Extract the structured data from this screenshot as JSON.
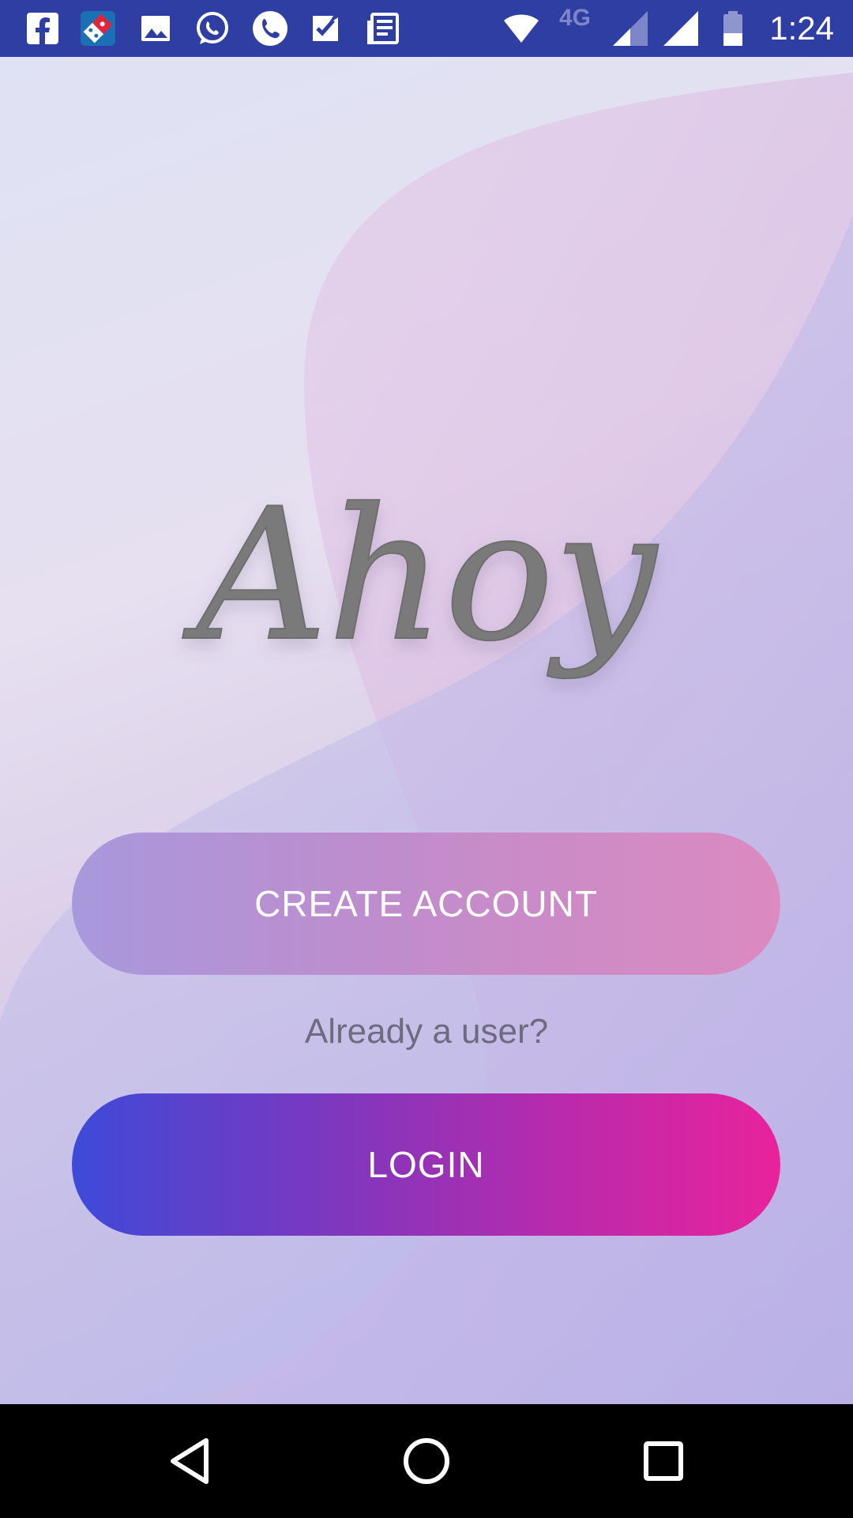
{
  "status_bar": {
    "time": "1:24",
    "network_type": "4G",
    "left_icons": [
      "facebook-icon",
      "dominos-icon",
      "gallery-icon",
      "whatsapp-icon",
      "phone-icon",
      "tasks-icon",
      "news-icon"
    ],
    "right_icons": [
      "wifi-icon",
      "signal-icon",
      "signal-icon",
      "battery-icon"
    ],
    "background_color": "#2f3ea3"
  },
  "app": {
    "logo_text": "Ahoy",
    "create_account_label": "CREATE ACCOUNT",
    "already_user_text": "Already a user?",
    "login_label": "LOGIN",
    "colors": {
      "create_gradient": [
        "#a898dd",
        "#dc8ac0"
      ],
      "login_gradient": [
        "#3e4ad8",
        "#ea229c"
      ]
    }
  },
  "nav_bar": {
    "buttons": [
      "back-icon",
      "home-icon",
      "recents-icon"
    ]
  }
}
